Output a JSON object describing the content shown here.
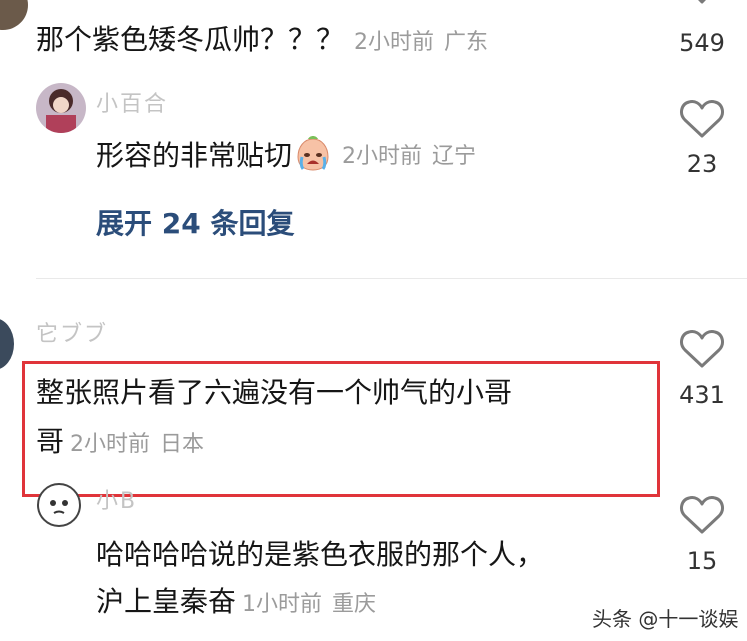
{
  "comment1": {
    "text": "那个紫色矮冬瓜帅？？？",
    "time": "2小时前",
    "location": "广东",
    "likes": "549"
  },
  "reply1": {
    "username": "小百合",
    "text": "形容的非常贴切",
    "time": "2小时前",
    "location": "辽宁",
    "likes": "23"
  },
  "expand_replies": "展开 24 条回复",
  "comment2": {
    "username": "它ブブ",
    "text_line1": "整张照片看了六遍没有一个帅气的小哥",
    "text_line2": "哥",
    "time": "2小时前",
    "location": "日本",
    "likes": "431"
  },
  "reply2": {
    "username": "小B",
    "text_line1": "哈哈哈哈说的是紫色衣服的那个人，",
    "text_line2": "沪上皇秦奋",
    "time": "1小时前",
    "location": "重庆",
    "likes": "15"
  },
  "watermark": "头条 @十一谈娱",
  "colors": {
    "highlight": "#e0343a",
    "link": "#2b4d7a"
  }
}
